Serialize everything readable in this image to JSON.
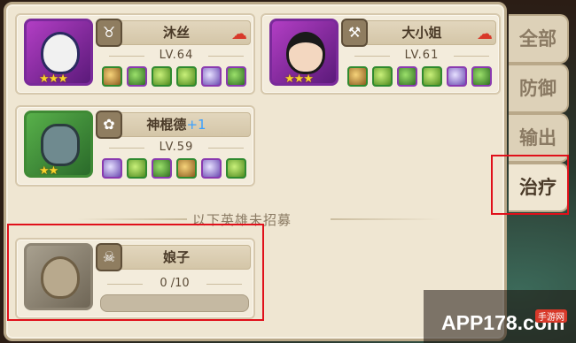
{
  "heroes_recruited": [
    {
      "name": "沐丝",
      "name_suffix": "",
      "level": "LV.64",
      "stars": "★★★",
      "class_icon": "bull-class-icon",
      "frame": "purple"
    },
    {
      "name": "大小姐",
      "name_suffix": "",
      "level": "LV.61",
      "stars": "★★★",
      "class_icon": "hammer-class-icon",
      "frame": "purple"
    },
    {
      "name": "神棍德",
      "name_suffix": "+1",
      "level": "LV.59",
      "stars": "★★",
      "class_icon": "paw-class-icon",
      "frame": "green"
    }
  ],
  "divider_label": "以下英雄未招募",
  "hero_unrecruited": {
    "name": "娘子",
    "fragments": "0 /10",
    "fragments_fill": 0,
    "class_icon": "skull-class-icon"
  },
  "tabs": [
    "全部",
    "防御",
    "输出",
    "治疗"
  ],
  "active_tab": "治疗",
  "watermark": {
    "main": "APP178.com",
    "sub": "手游网"
  },
  "colors": {
    "highlight": "#e0101a",
    "panel": "#efe6d2",
    "level_plus": "#3aa0ff"
  }
}
